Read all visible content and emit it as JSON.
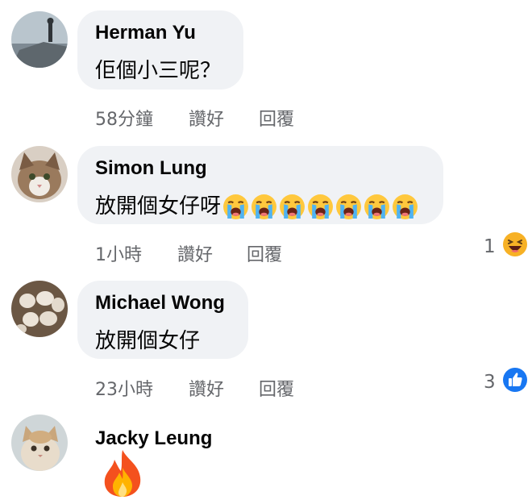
{
  "comments": [
    {
      "author": "Herman Yu",
      "text": "佢個小三呢？",
      "time": "58分鐘",
      "like_label": "讚好",
      "reply_label": "回覆"
    },
    {
      "author": "Simon Lung",
      "text": "放開個女仔呀",
      "emojis": [
        "crying-face-icon",
        "crying-face-icon",
        "crying-face-icon",
        "crying-face-icon",
        "crying-face-icon",
        "crying-face-icon",
        "crying-face-icon"
      ],
      "time": "1小時",
      "like_label": "讚好",
      "reply_label": "回覆",
      "reaction_count": "1",
      "reaction_icon": "haha-reaction-icon"
    },
    {
      "author": "Michael Wong",
      "text": "放開個女仔",
      "time": "23小時",
      "like_label": "讚好",
      "reply_label": "回覆",
      "reaction_count": "3",
      "reaction_icon": "like-reaction-icon"
    },
    {
      "author": "Jacky Leung",
      "emoji": "fire-icon"
    }
  ],
  "colors": {
    "bubble": "#f0f2f5",
    "meta_text": "#65676b",
    "like_blue": "#1877f2"
  }
}
